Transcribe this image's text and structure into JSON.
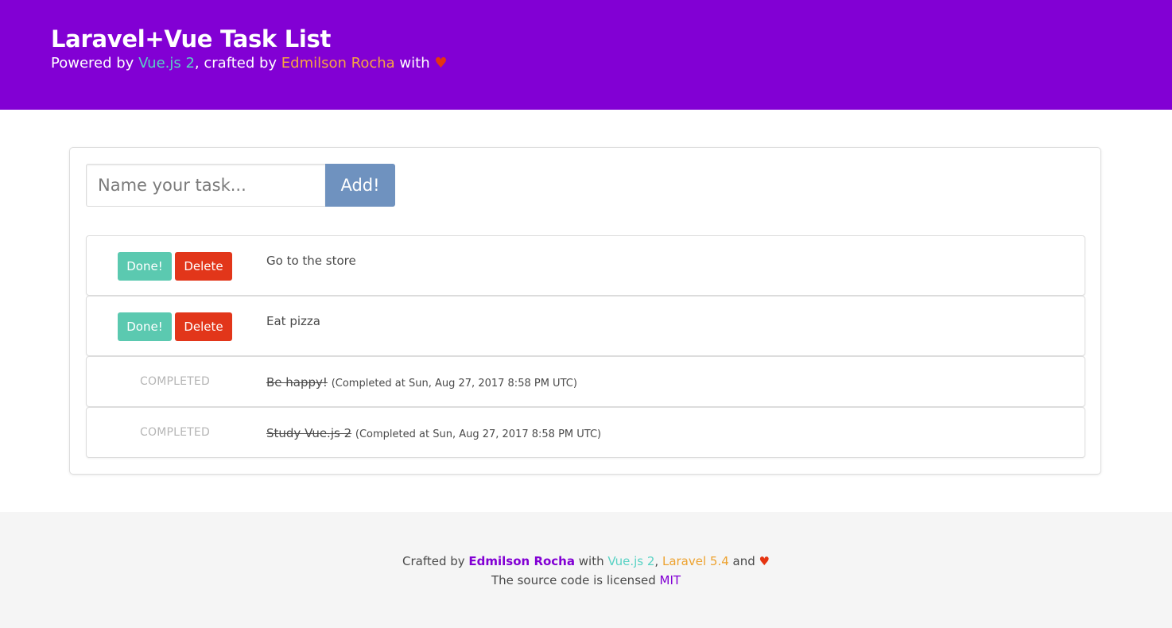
{
  "hero": {
    "title": "Laravel+Vue Task List",
    "subtitle_prefix": "Powered by ",
    "vue_link": "Vue.js 2",
    "subtitle_mid": ", crafted by ",
    "author_link": "Edmilson Rocha",
    "subtitle_suffix": " with ",
    "heart": "♥",
    "background_color": "#8200d4"
  },
  "form": {
    "input_value": "",
    "input_placeholder": "Name your task...",
    "add_label": "Add!"
  },
  "tasks": {
    "pending": [
      {
        "name": "Go to the store",
        "done_label": "Done!",
        "delete_label": "Delete"
      },
      {
        "name": "Eat pizza",
        "done_label": "Done!",
        "delete_label": "Delete"
      }
    ],
    "completed": [
      {
        "label": "COMPLETED",
        "name": "Be happy!",
        "stamp": "(Completed at Sun, Aug 27, 2017 8:58 PM UTC)"
      },
      {
        "label": "COMPLETED",
        "name": "Study Vue.js 2",
        "stamp": "(Completed at Sun, Aug 27, 2017 8:58 PM UTC)"
      }
    ]
  },
  "footer": {
    "line1_prefix": "Crafted by ",
    "author": "Edmilson Rocha",
    "with": " with ",
    "vue": "Vue.js 2",
    "comma": ", ",
    "laravel": "Laravel 5.4",
    "and": " and ",
    "heart": "♥",
    "line2_prefix": "The source code is licensed ",
    "license": "MIT"
  },
  "colors": {
    "brand": "#8200d4",
    "done": "#5bc9b0",
    "delete": "#e2361a",
    "add": "#6f92bf"
  }
}
